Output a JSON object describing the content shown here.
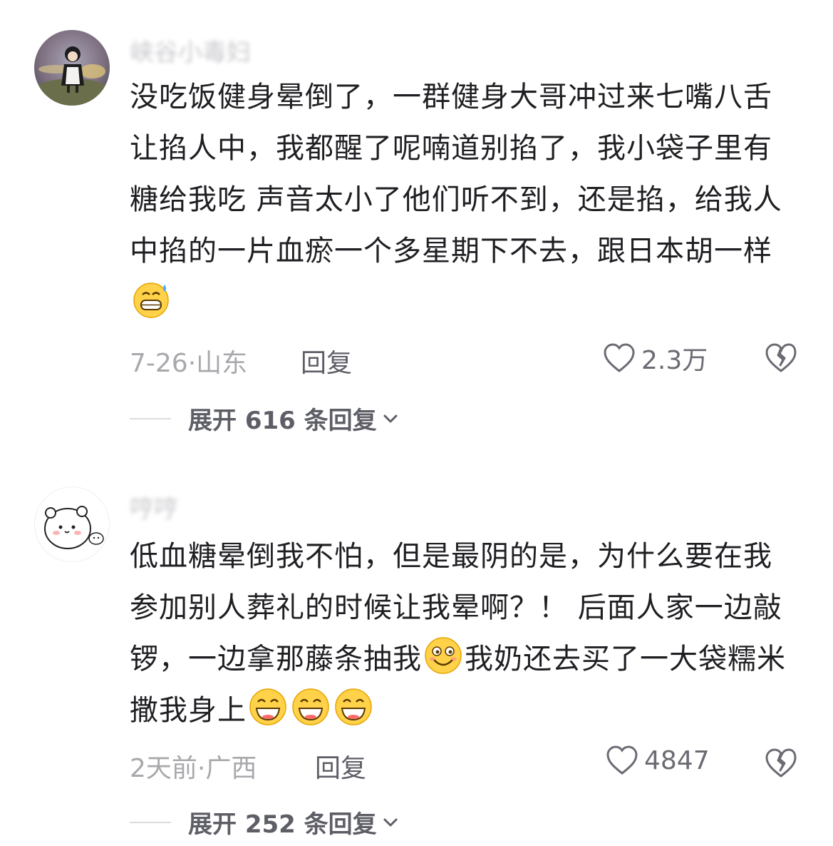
{
  "comments": [
    {
      "username": "峡谷小毒妇",
      "text_before": "没吃饭健身晕倒了，一群健身大哥冲过来七嘴八舌让掐人中，我都醒了呢喃道别掐了，我小袋子里有糖给我吃 声音太小了他们听不到，还是掐，给我人中掐的一片血瘀一个多星期下不去，跟日本胡一样",
      "emoji_after": "grinning-sweat-emoji",
      "date": "7-26",
      "location": "山东",
      "reply_label": "回复",
      "likes": "2.3万",
      "expand_label": "展开 616 条回复"
    },
    {
      "username": "哼哼",
      "text_part1": "低血糖晕倒我不怕，但是最阴的是，为什么要在我参加别人葬礼的时候让我晕啊？！ 后面人家一边敲锣，一边拿那藤条抽我",
      "emoji_mid": "smirk-emoji",
      "text_part2": "我奶还去买了一大袋糯米撒我身上",
      "emoji_end": "grin-emoji",
      "date": "2天前",
      "location": "广西",
      "reply_label": "回复",
      "likes": "4847",
      "expand_label": "展开 252 条回复"
    }
  ],
  "meta_separator": "·",
  "colors": {
    "text": "#1f1f23",
    "meta": "#a8a8ad",
    "action": "#5d5e66"
  }
}
